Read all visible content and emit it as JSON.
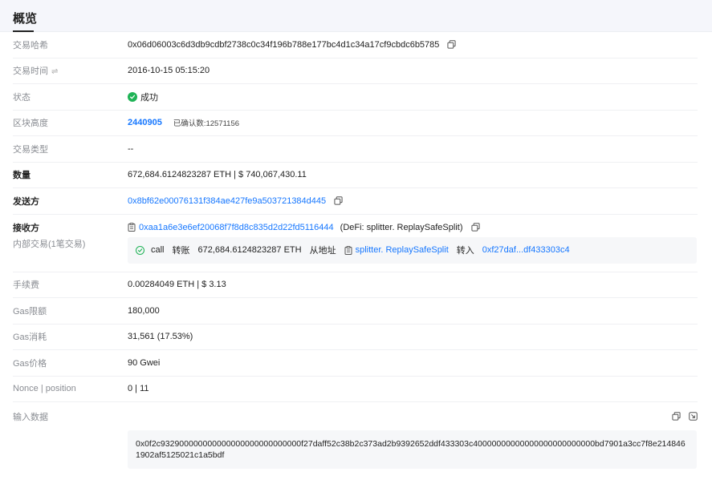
{
  "header": {
    "title": "概览"
  },
  "rows": {
    "tx_hash": {
      "label": "交易哈希",
      "value": "0x06d06003c6d3db9cdbf2738c0c34f196b788e177bc4d1c34a17cf9cbdc6b5785"
    },
    "tx_time": {
      "label": "交易时间",
      "swap": "⇌",
      "value": "2016-10-15 05:15:20"
    },
    "status": {
      "label": "状态",
      "value": "成功"
    },
    "block": {
      "label": "区块高度",
      "value": "2440905",
      "confirm": "已确认数:12571156"
    },
    "tx_type": {
      "label": "交易类型",
      "value": "--"
    },
    "amount": {
      "label": "数量",
      "value": "672,684.6124823287 ETH | $ 740,067,430.11"
    },
    "sender": {
      "label": "发送方",
      "value": "0x8bf62e00076131f384ae427fe9a503721384d445"
    },
    "receiver": {
      "label": "接收方",
      "value": "0xaa1a6e3e6ef20068f7f8d8c835d2d22fd5116444",
      "note": "(DeFi: splitter. ReplaySafeSplit)"
    },
    "internal": {
      "label": "内部交易(1笔交易)",
      "call": "call",
      "transfer": "转账",
      "amount": "672,684.6124823287 ETH",
      "from_label": "从地址",
      "from": "splitter. ReplaySafeSplit",
      "to_label": "转入",
      "to": "0xf27daf...df433303c4"
    },
    "fee": {
      "label": "手续费",
      "value": "0.00284049 ETH | $ 3.13"
    },
    "gas_limit": {
      "label": "Gas限额",
      "value": "180,000"
    },
    "gas_used": {
      "label": "Gas消耗",
      "value": "31,561 (17.53%)"
    },
    "gas_price": {
      "label": "Gas价格",
      "value": "90 Gwei"
    },
    "nonce": {
      "label": "Nonce | position",
      "value": "0 | 11"
    },
    "input": {
      "label": "输入数据",
      "value": "0x0f2c932900000000000000000000000000f27daff52c38b2c373ad2b9392652ddf433303c40000000000000000000000000bd7901a3cc7f8e2148461902af5125021c1a5bdf"
    }
  }
}
